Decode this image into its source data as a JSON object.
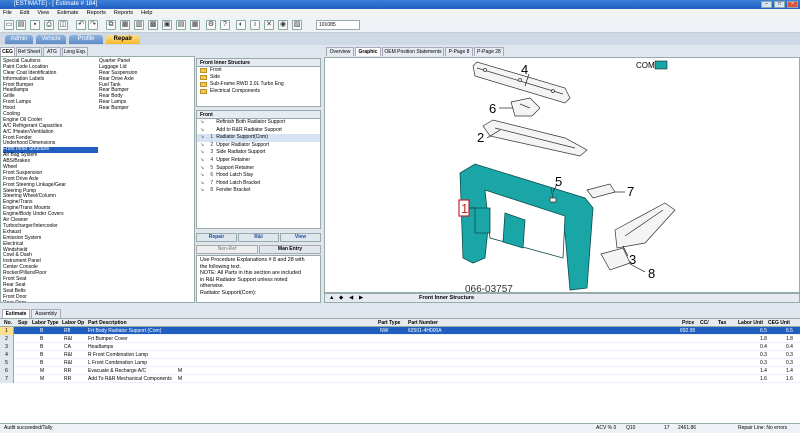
{
  "window": {
    "title": "[ESTIMATE] - [ Estimate # 184]"
  },
  "menu": [
    "File",
    "Edit",
    "View",
    "Estimate",
    "Reports",
    "Reports",
    "Help"
  ],
  "toolbar": {
    "estimate_id": "101085"
  },
  "nav_tabs": [
    "Admin",
    "Vehicle",
    "Profile",
    "Repair"
  ],
  "active_nav": "Repair",
  "left_tabs": [
    "CEG",
    "Ref Sheet",
    "ATG",
    "Long Exp."
  ],
  "categories_col1": [
    "Special Cautions",
    "Paint Code Location",
    "Clear Coat Identification",
    "Information Labels",
    "Front Bumper",
    "Headlamps",
    "Grille",
    "Front Lamps",
    "Hood",
    "Cooling",
    "Engine Oil Cooler",
    "A/C Refrigerant Capacities",
    "A/C /Heater/Ventilation",
    "Front Fender",
    "Underhood Dimensions",
    "Front Inner Structure",
    "Air Bag System",
    "ABS/Brakes",
    "Wheel",
    "Front Suspension",
    "Front Drive Axle",
    "Front Steering Linkage/Gear",
    "Steering Pump",
    "Steering Wheel/Column",
    "Engine/Trans",
    "Engine/Trans Mounts",
    "Engine/Body Under Covers",
    "Air Cleaner",
    "Turbocharger/Intercooler",
    "Exhaust",
    "Emission System",
    "Electrical",
    "Windshield",
    "Cowl & Dash",
    "Instrument Panel",
    "Center Console",
    "Rocker/Pillars/Floor",
    "Front Seat",
    "Rear Seat",
    "Seat Belts",
    "Front Door",
    "Rear Door",
    "Roof",
    "Sunroof",
    "Back Window"
  ],
  "categories_col2": [
    "Quarter Panel",
    "Luggage Lid",
    "Rear Suspension",
    "Rear Drive Axle",
    "Fuel Tank",
    "Rear Bumper",
    "Rear Body",
    "Rear Lamps",
    "Rear Bumper"
  ],
  "selected_category": "Front Inner Structure",
  "tree": {
    "header": "Front Inner Structure",
    "items": [
      "Front",
      "Side",
      "Sub-Frame RWD 2.0L Turbo Eng",
      "Electrical Components"
    ]
  },
  "parts": {
    "header": "Front",
    "items": [
      {
        "num": "",
        "label": "Refinish Both Radiator Support"
      },
      {
        "num": "",
        "label": "Add to R&R Radiator Support"
      },
      {
        "num": "1",
        "label": "Radiator Support(Com)"
      },
      {
        "num": "2",
        "label": "Upper Radiator Support"
      },
      {
        "num": "3",
        "label": "Side Radiator Support"
      },
      {
        "num": "4",
        "label": "Upper Retainer"
      },
      {
        "num": "5",
        "label": "Support Retainer"
      },
      {
        "num": "6",
        "label": "Hood Latch Stay"
      },
      {
        "num": "7",
        "label": "Hood Latch Bracket"
      },
      {
        "num": "8",
        "label": "Fender Bracket"
      }
    ],
    "selected_index": 2
  },
  "action_buttons": [
    "Repair",
    "R&I",
    "View"
  ],
  "sub_buttons": [
    "Non-Ref",
    "Man Entry"
  ],
  "notes": [
    "Use Procedure Explanations # 8 and 28 with",
    "the following text.",
    "NOTE: All Parts in this section are included",
    "in R&I Radiator Support unless noted",
    "otherwise.",
    "Radiator Support(Com):"
  ],
  "graphic_tabs": [
    "Overview",
    "Graphic",
    "OEM Position Statements",
    "P-Page 8",
    "P-Page 28"
  ],
  "active_graphic_tab": "Graphic",
  "graphic": {
    "legend_label": "COM",
    "diagram_id": "066-03757",
    "callouts": [
      "1",
      "2",
      "3",
      "4",
      "5",
      "6",
      "7",
      "8"
    ],
    "footer_title": "Front Inner Structure",
    "highlight_color": "#1aa6a6"
  },
  "bottom_tabs": [
    "Estimate",
    "Assembly"
  ],
  "estimate_columns": [
    "No.",
    "Sup",
    "Labor Type",
    "Labor Op",
    "Part Description",
    "Part Type",
    "Part Number",
    "Price",
    "CC/",
    "Tax",
    "Labor Unit",
    "CEG Unit"
  ],
  "estimate_rows": [
    {
      "no": "1",
      "labor_type": "B",
      "labor_op": "Rfl",
      "desc": "Frt Body Radiator Support (Com)",
      "part_type": "NW",
      "part_number": "62501-4H000A",
      "price": "692.95",
      "labor_unit": "6.5",
      "ceg_unit": "6.5"
    },
    {
      "no": "2",
      "labor_type": "B",
      "labor_op": "R&I",
      "desc": "Frt Bumper Cover",
      "part_type": "",
      "part_number": "",
      "price": "",
      "labor_unit": "1.8",
      "ceg_unit": "1.8"
    },
    {
      "no": "3",
      "labor_type": "B",
      "labor_op": "CA",
      "desc": "Headlamps",
      "part_type": "",
      "part_number": "",
      "price": "",
      "labor_unit": "0.4",
      "ceg_unit": "0.4"
    },
    {
      "no": "4",
      "labor_type": "B",
      "labor_op": "R&I",
      "desc": "R Front Combination Lamp",
      "part_type": "",
      "part_number": "",
      "price": "",
      "labor_unit": "0.3",
      "ceg_unit": "0.3"
    },
    {
      "no": "5",
      "labor_type": "B",
      "labor_op": "R&I",
      "desc": "L Front Combination Lamp",
      "part_type": "",
      "part_number": "",
      "price": "",
      "labor_unit": "0.3",
      "ceg_unit": "0.3"
    },
    {
      "no": "6",
      "labor_type": "M",
      "labor_op": "RR",
      "desc": "Evacuate & Recharge A/C",
      "flag": "M",
      "part_type": "",
      "part_number": "",
      "price": "",
      "labor_unit": "1.4",
      "ceg_unit": "1.4"
    },
    {
      "no": "7",
      "labor_type": "M",
      "labor_op": "RR",
      "desc": "Add To R&R Mechanical Components",
      "flag": "M",
      "part_type": "",
      "part_number": "",
      "price": "",
      "labor_unit": "1.6",
      "ceg_unit": "1.6"
    }
  ],
  "selected_row": 0,
  "status": {
    "left": "Audit succeeded/Tally",
    "acv": "ACV % 0",
    "q": "Q10",
    "count": "17",
    "total": "2461.86",
    "right": "Repair Line: No errors"
  }
}
